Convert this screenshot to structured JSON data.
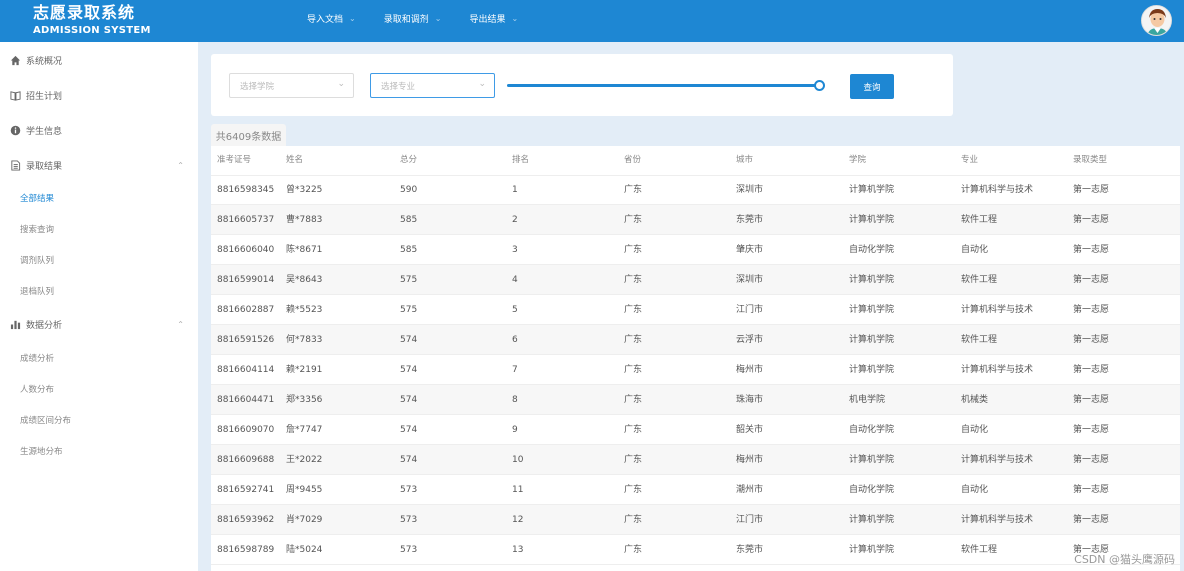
{
  "header": {
    "title_cn": "志愿录取系统",
    "title_en": "ADMISSION SYSTEM",
    "nav": [
      {
        "label": "导入文档"
      },
      {
        "label": "录取和调剂"
      },
      {
        "label": "导出结果"
      }
    ],
    "avatar_icon": "user-avatar-icon"
  },
  "sidebar": {
    "groups": [
      {
        "label": "系统概况",
        "icon": "home-icon"
      },
      {
        "label": "招生计划",
        "icon": "book-icon"
      },
      {
        "label": "学生信息",
        "icon": "info-icon"
      },
      {
        "label": "录取结果",
        "icon": "document-icon",
        "expanded": true,
        "children": [
          "全部结果",
          "搜索查询",
          "调剂队列",
          "退档队列"
        ]
      },
      {
        "label": "数据分析",
        "icon": "bar-chart-icon",
        "expanded": true,
        "children": [
          "成绩分析",
          "人数分布",
          "成绩区间分布",
          "生源地分布"
        ]
      }
    ],
    "active_item": "全部结果"
  },
  "filters": {
    "college_placeholder": "选择学院",
    "major_placeholder": "选择专业",
    "slider_level": 1.0,
    "query_label": "查询"
  },
  "count_label": "共6409条数据",
  "table": {
    "columns": [
      "准考证号",
      "姓名",
      "总分",
      "排名",
      "省份",
      "城市",
      "学院",
      "专业",
      "录取类型"
    ],
    "rows": [
      [
        "8816598345",
        "曾*3225",
        "590",
        "1",
        "广东",
        "深圳市",
        "计算机学院",
        "计算机科学与技术",
        "第一志愿"
      ],
      [
        "8816605737",
        "曹*7883",
        "585",
        "2",
        "广东",
        "东莞市",
        "计算机学院",
        "软件工程",
        "第一志愿"
      ],
      [
        "8816606040",
        "陈*8671",
        "585",
        "3",
        "广东",
        "肇庆市",
        "自动化学院",
        "自动化",
        "第一志愿"
      ],
      [
        "8816599014",
        "吴*8643",
        "575",
        "4",
        "广东",
        "深圳市",
        "计算机学院",
        "软件工程",
        "第一志愿"
      ],
      [
        "8816602887",
        "赖*5523",
        "575",
        "5",
        "广东",
        "江门市",
        "计算机学院",
        "计算机科学与技术",
        "第一志愿"
      ],
      [
        "8816591526",
        "何*7833",
        "574",
        "6",
        "广东",
        "云浮市",
        "计算机学院",
        "软件工程",
        "第一志愿"
      ],
      [
        "8816604114",
        "赖*2191",
        "574",
        "7",
        "广东",
        "梅州市",
        "计算机学院",
        "计算机科学与技术",
        "第一志愿"
      ],
      [
        "8816604471",
        "郑*3356",
        "574",
        "8",
        "广东",
        "珠海市",
        "机电学院",
        "机械类",
        "第一志愿"
      ],
      [
        "8816609070",
        "詹*7747",
        "574",
        "9",
        "广东",
        "韶关市",
        "自动化学院",
        "自动化",
        "第一志愿"
      ],
      [
        "8816609688",
        "王*2022",
        "574",
        "10",
        "广东",
        "梅州市",
        "计算机学院",
        "计算机科学与技术",
        "第一志愿"
      ],
      [
        "8816592741",
        "周*9455",
        "573",
        "11",
        "广东",
        "潮州市",
        "自动化学院",
        "自动化",
        "第一志愿"
      ],
      [
        "8816593962",
        "肖*7029",
        "573",
        "12",
        "广东",
        "江门市",
        "计算机学院",
        "计算机科学与技术",
        "第一志愿"
      ],
      [
        "8816598789",
        "陆*5024",
        "573",
        "13",
        "广东",
        "东莞市",
        "计算机学院",
        "软件工程",
        "第一志愿"
      ]
    ]
  },
  "watermark": "CSDN @猫头鹰源码"
}
